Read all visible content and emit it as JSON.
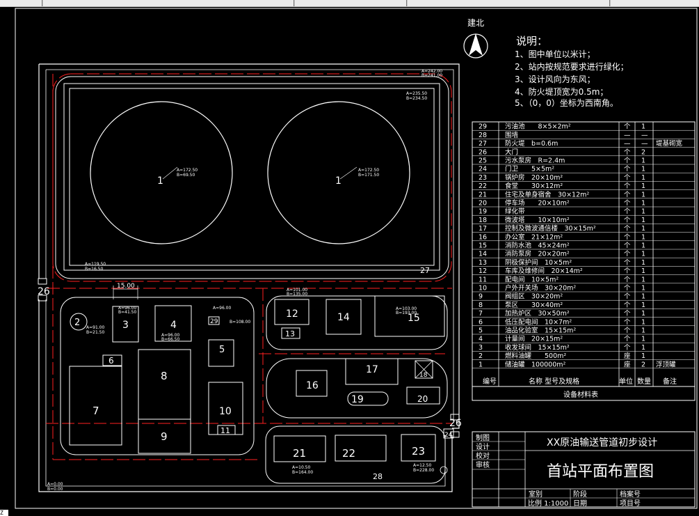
{
  "north": {
    "label": "建北"
  },
  "notes": {
    "title": "说明：",
    "items": [
      "1、图中单位以米计；",
      "2、站内按规范要求进行绿化；",
      "3、设计风向为东风；",
      "4、防火堤顶宽为0.5m；",
      "5、（0，0）坐标为西南角。"
    ]
  },
  "equipment_table": {
    "caption": "设备材料表",
    "header": {
      "no": "编号",
      "name": "名称 型号及规格",
      "unit": "单位",
      "qty": "数量",
      "remark": "备注"
    },
    "rows": [
      {
        "no": "29",
        "name": "污油池　　8×5×2m²",
        "unit": "个",
        "qty": "1",
        "remark": ""
      },
      {
        "no": "28",
        "name": "围墙",
        "unit": "—",
        "qty": "—",
        "remark": ""
      },
      {
        "no": "27",
        "name": "防火堤　b=0.6m",
        "unit": "—",
        "qty": "—",
        "remark": "堤基砌宽"
      },
      {
        "no": "26",
        "name": "大门",
        "unit": "个",
        "qty": "2",
        "remark": ""
      },
      {
        "no": "25",
        "name": "污水泵房　R=2.4m",
        "unit": "个",
        "qty": "1",
        "remark": ""
      },
      {
        "no": "24",
        "name": "门卫　　5×5m²",
        "unit": "个",
        "qty": "1",
        "remark": ""
      },
      {
        "no": "23",
        "name": "锅炉房　20×10m²",
        "unit": "个",
        "qty": "1",
        "remark": ""
      },
      {
        "no": "22",
        "name": "食堂　　30×12m²",
        "unit": "个",
        "qty": "1",
        "remark": ""
      },
      {
        "no": "21",
        "name": "住宅及单身宿舍　30×12m²",
        "unit": "个",
        "qty": "1",
        "remark": ""
      },
      {
        "no": "20",
        "name": "停车场　　20×10m²",
        "unit": "个",
        "qty": "1",
        "remark": ""
      },
      {
        "no": "19",
        "name": "绿化带",
        "unit": "个",
        "qty": "1",
        "remark": ""
      },
      {
        "no": "18",
        "name": "微波塔　　10×10m²",
        "unit": "个",
        "qty": "1",
        "remark": ""
      },
      {
        "no": "17",
        "name": "控制及微波通信楼　30×15m²",
        "unit": "个",
        "qty": "1",
        "remark": ""
      },
      {
        "no": "16",
        "name": "办公室　21×12m²",
        "unit": "个",
        "qty": "1",
        "remark": ""
      },
      {
        "no": "15",
        "name": "消防水池　45×24m²",
        "unit": "个",
        "qty": "1",
        "remark": ""
      },
      {
        "no": "14",
        "name": "消防泵房　20×20m²",
        "unit": "个",
        "qty": "1",
        "remark": ""
      },
      {
        "no": "13",
        "name": "阴极保护间　10×5m²",
        "unit": "个",
        "qty": "1",
        "remark": ""
      },
      {
        "no": "12",
        "name": "车库及维修间　20×14m²",
        "unit": "个",
        "qty": "1",
        "remark": ""
      },
      {
        "no": "11",
        "name": "配电间　10×5m²",
        "unit": "个",
        "qty": "1",
        "remark": ""
      },
      {
        "no": "10",
        "name": "户外开关场　30×20m²",
        "unit": "个",
        "qty": "1",
        "remark": ""
      },
      {
        "no": "9",
        "name": "阀组区　30×20m²",
        "unit": "个",
        "qty": "1",
        "remark": ""
      },
      {
        "no": "8",
        "name": "泵区　　30×40m²",
        "unit": "个",
        "qty": "1",
        "remark": ""
      },
      {
        "no": "7",
        "name": "加热炉区　30×50m²",
        "unit": "个",
        "qty": "1",
        "remark": ""
      },
      {
        "no": "6",
        "name": "低压配电间　10×7m²",
        "unit": "个",
        "qty": "1",
        "remark": ""
      },
      {
        "no": "5",
        "name": "油品化验室　15×15m²",
        "unit": "个",
        "qty": "1",
        "remark": ""
      },
      {
        "no": "4",
        "name": "计量间　20×15m²",
        "unit": "个",
        "qty": "1",
        "remark": ""
      },
      {
        "no": "3",
        "name": "收发球间　15×15m²",
        "unit": "个",
        "qty": "1",
        "remark": ""
      },
      {
        "no": "2",
        "name": "燃料油罐　　500m²",
        "unit": "座",
        "qty": "1",
        "remark": ""
      },
      {
        "no": "1",
        "name": "储油罐　100000m²",
        "unit": "座",
        "qty": "2",
        "remark": "浮顶罐"
      }
    ]
  },
  "title_block": {
    "roles": [
      "制图",
      "设计",
      "校对",
      "审核"
    ],
    "project": "XX原油输送管道初步设计",
    "drawing": "首站平面布置图",
    "footer": {
      "dept": "室别",
      "stage": "阶段",
      "archive": "档案号",
      "scale": "比例 1:1000",
      "date": "日期",
      "item": "项目号"
    }
  },
  "plan": {
    "dimension": "15.00",
    "labels": {
      "b1a": "1",
      "b1b": "1",
      "b2": "2",
      "b3": "3",
      "b4": "4",
      "b5": "5",
      "b6": "6",
      "b7": "7",
      "b8": "8",
      "b9": "9",
      "b10": "10",
      "b11": "11",
      "b12": "12",
      "b13": "13",
      "b14": "14",
      "b15": "15",
      "b16": "16",
      "b17": "17",
      "b18": "18",
      "b19": "19",
      "b20": "20",
      "b21": "21",
      "b22": "22",
      "b23": "23",
      "b24": "24",
      "b26a": "26",
      "b26b": "26",
      "b27": "27",
      "b28": "28",
      "b29": "29"
    },
    "coords": [
      [
        "A=172.50",
        "B=69.50"
      ],
      [
        "A=172.50",
        "B=171.50"
      ],
      [
        "A=242.00",
        "B=241.00"
      ],
      [
        "A=235.50",
        "B=234.50"
      ],
      [
        "A=119.50",
        "B=16.50"
      ],
      [
        "A=101.00",
        "B=135.00"
      ],
      [
        "A=96.00",
        "B=41.50"
      ],
      [
        "A=96.00",
        "B=66.50"
      ],
      [
        "A=96.00",
        "B=108.00"
      ],
      [
        "A=91.00",
        "B=21.50"
      ],
      [
        "A=103.00",
        "B=193.00"
      ],
      [
        "A=0.00",
        "B=0.00"
      ],
      [
        "A=10.50",
        "B=164.00"
      ],
      [
        "A=12.50",
        "B=228.00"
      ]
    ]
  }
}
